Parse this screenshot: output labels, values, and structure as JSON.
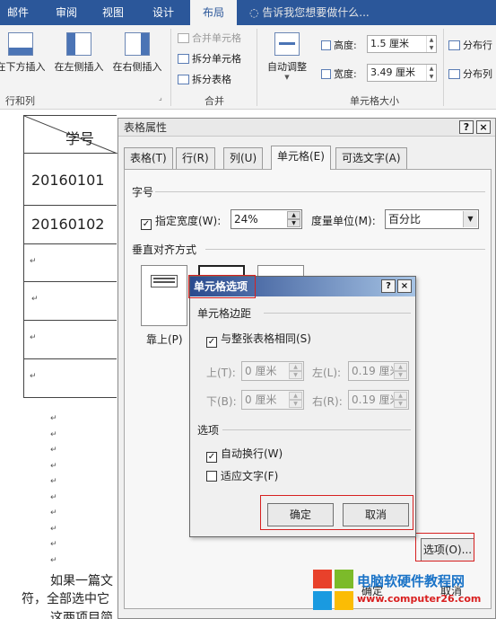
{
  "ribbon": {
    "tabs": [
      "邮件",
      "审阅",
      "视图",
      "设计",
      "布局"
    ],
    "active_tab": "布局",
    "tell_me": "告诉我您想要做什么...",
    "insert_below": "在下方插入",
    "insert_left": "在左侧插入",
    "insert_right": "在右侧插入",
    "group_rows_cols": "行和列",
    "merge_cells": "合并单元格",
    "split_cells": "拆分单元格",
    "split_table": "拆分表格",
    "group_merge": "合并",
    "autofit": "自动调整",
    "height_label": "高度:",
    "height_value": "1.5 厘米",
    "width_label": "宽度:",
    "width_value": "3.49 厘米",
    "distribute_rows": "分布行",
    "distribute_cols": "分布列",
    "group_cell_size": "单元格大小"
  },
  "document": {
    "header_cell": "学号",
    "rows": [
      "20160101",
      "20160102"
    ],
    "para1": "如果一篇文",
    "para2": "符，全部选中它",
    "para3": "这两项目简"
  },
  "table_props": {
    "title": "表格属性",
    "help": "?",
    "close": "×",
    "tabs": [
      "表格(T)",
      "行(R)",
      "列(U)",
      "单元格(E)",
      "可选文字(A)"
    ],
    "active_tab": "单元格(E)",
    "section_size": "字号",
    "specify_width": "指定宽度(W):",
    "width_value": "24%",
    "unit_label": "度量单位(M):",
    "unit_value": "百分比",
    "section_valign": "垂直对齐方式",
    "align_top": "靠上(P)",
    "options_button": "选项(O)...",
    "ok": "确定",
    "cancel": "取消"
  },
  "cell_options": {
    "title": "单元格选项",
    "help": "?",
    "close": "×",
    "section_margins": "单元格边距",
    "same_as_table": "与整张表格相同(S)",
    "top_label": "上(T):",
    "top_value": "0 厘米",
    "left_label": "左(L):",
    "left_value": "0.19 厘米",
    "bottom_label": "下(B):",
    "bottom_value": "0 厘米",
    "right_label": "右(R):",
    "right_value": "0.19 厘米",
    "section_options": "选项",
    "wrap_text": "自动换行(W)",
    "fit_text": "适应文字(F)",
    "ok": "确定",
    "cancel": "取消"
  },
  "watermark": {
    "line1": "电脑软硬件教程网",
    "line2": "www.computer26.com",
    "colors": {
      "red": "#e8412b",
      "green": "#7cbb2a",
      "blue": "#1a9ae0",
      "yellow": "#fbbc05"
    }
  },
  "colors": {
    "ribbon_blue": "#2b579a",
    "highlight_red": "#d62020"
  }
}
